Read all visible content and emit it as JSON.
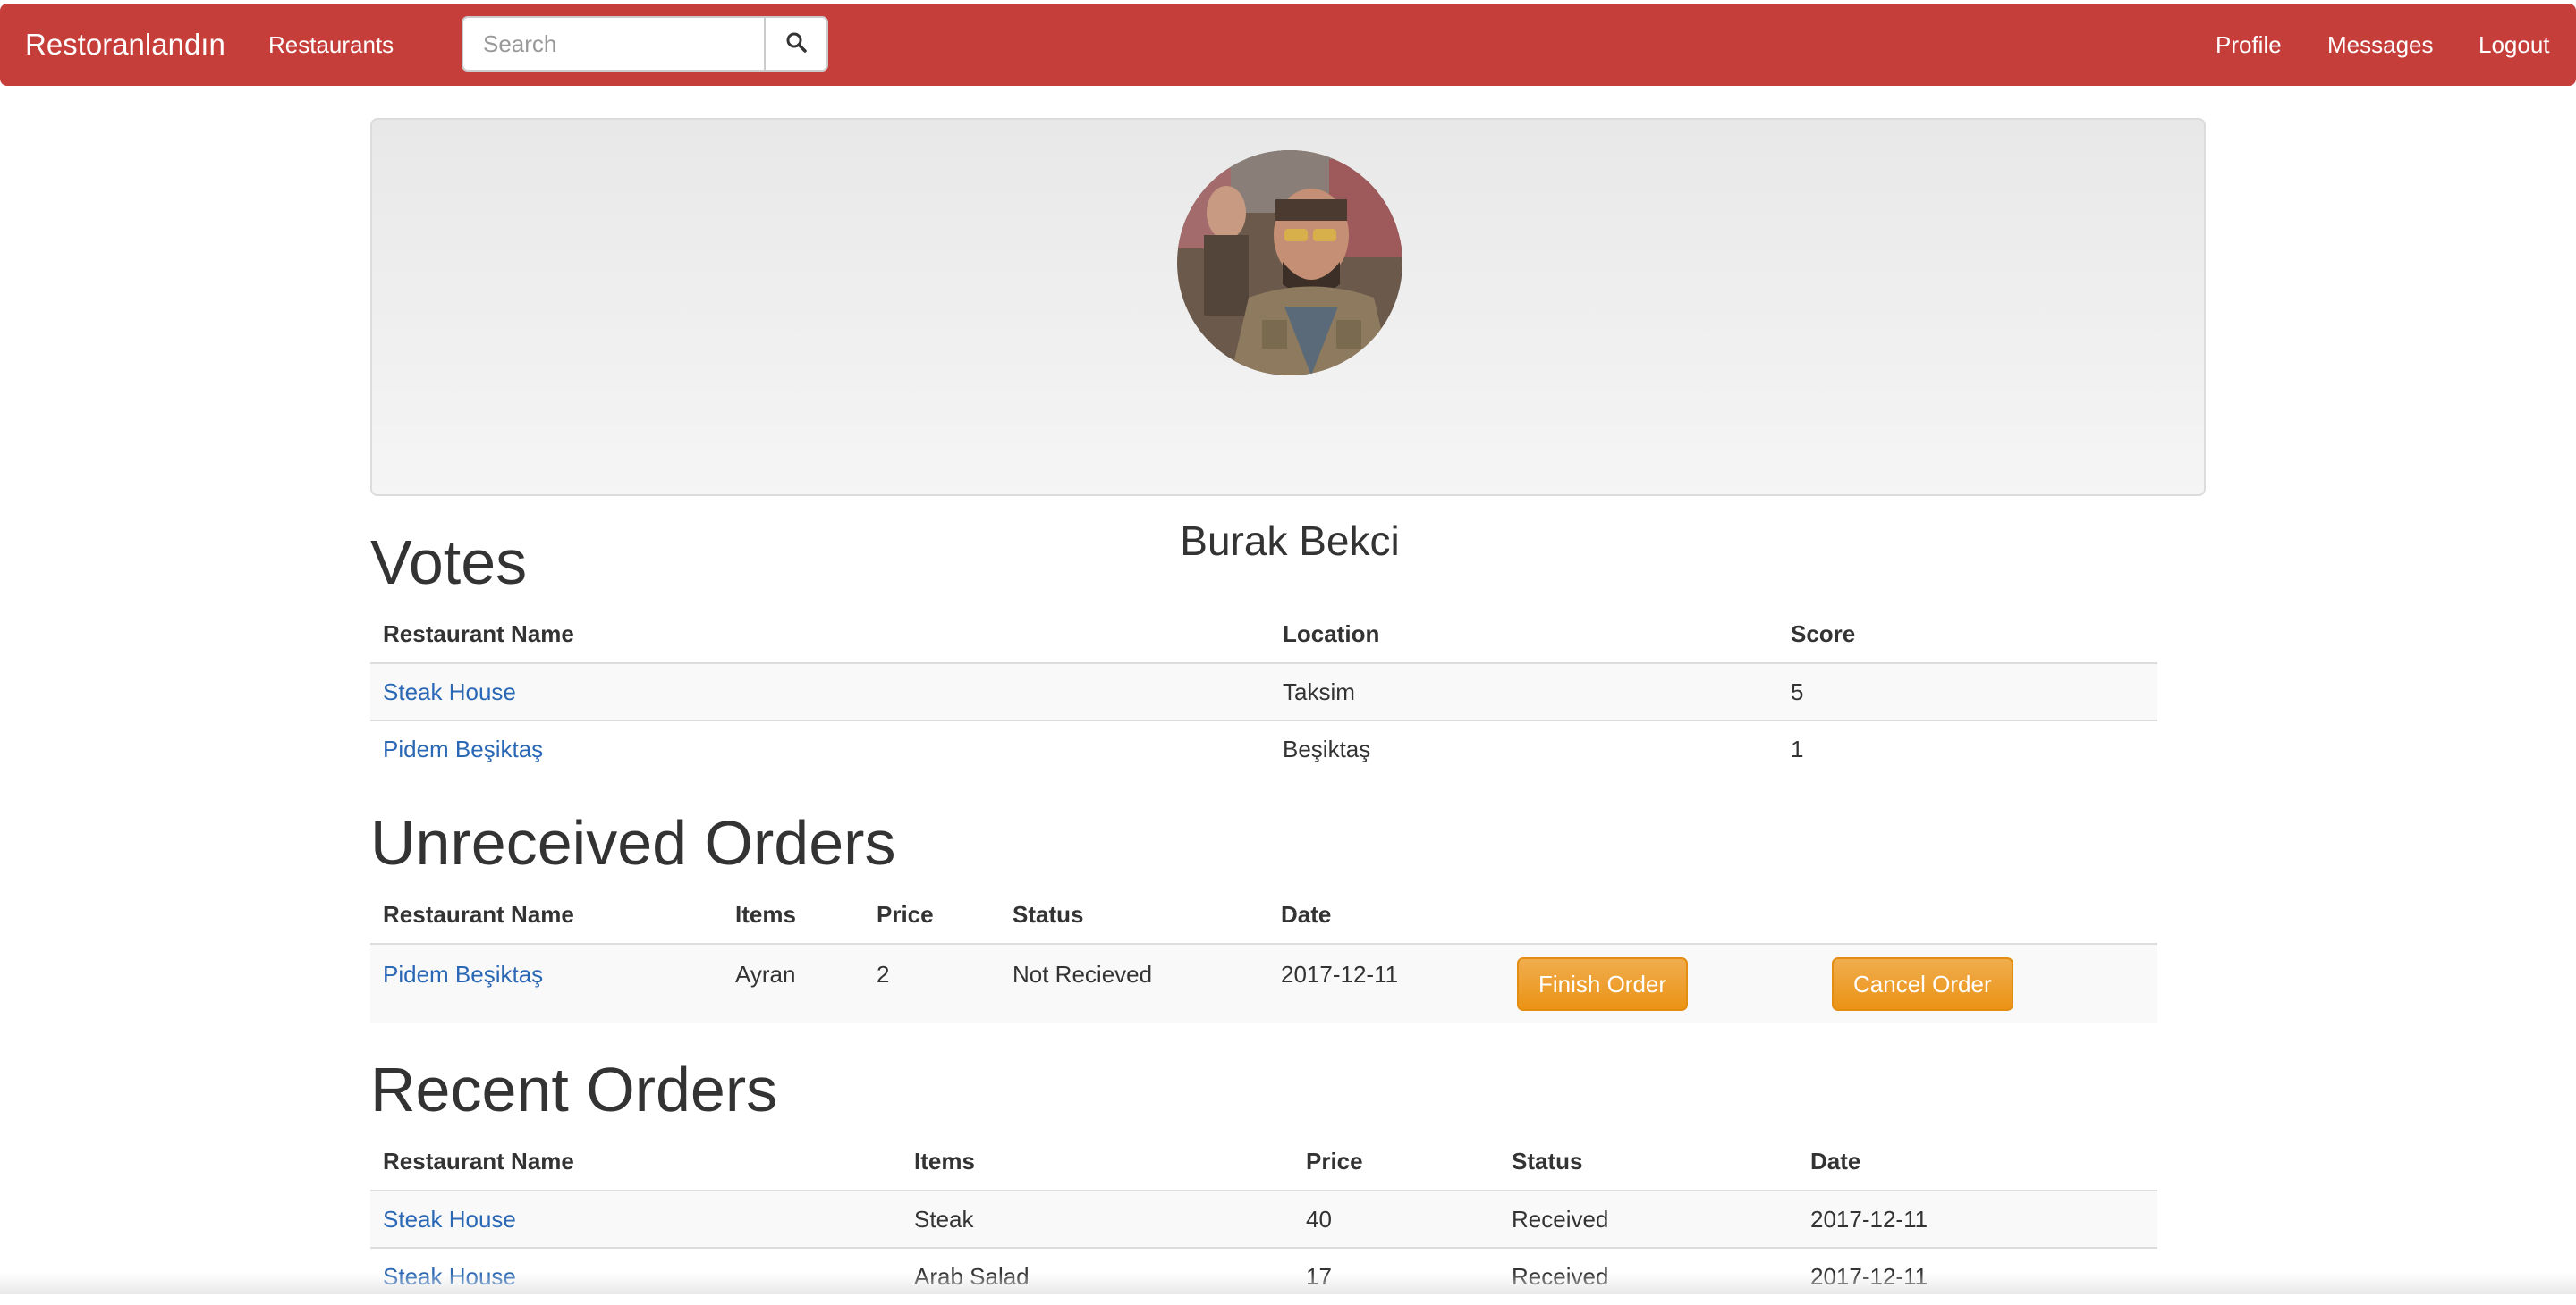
{
  "navbar": {
    "brand": "Restoranlandın",
    "restaurants": "Restaurants",
    "search_placeholder": "Search",
    "profile": "Profile",
    "messages": "Messages",
    "logout": "Logout"
  },
  "profile": {
    "name": "Burak Bekci"
  },
  "votes": {
    "title": "Votes",
    "headers": [
      "Restaurant Name",
      "Location",
      "Score"
    ],
    "rows": [
      {
        "restaurant": "Steak House",
        "location": "Taksim",
        "score": "5"
      },
      {
        "restaurant": "Pidem Beşiktaş",
        "location": "Beşiktaş",
        "score": "1"
      }
    ]
  },
  "unreceived": {
    "title": "Unreceived Orders",
    "headers": [
      "Restaurant Name",
      "Items",
      "Price",
      "Status",
      "Date"
    ],
    "rows": [
      {
        "restaurant": "Pidem Beşiktaş",
        "items": "Ayran",
        "price": "2",
        "status": "Not Recieved",
        "date": "2017-12-11",
        "finish_label": "Finish Order",
        "cancel_label": "Cancel Order"
      }
    ]
  },
  "recent": {
    "title": "Recent Orders",
    "headers": [
      "Restaurant Name",
      "Items",
      "Price",
      "Status",
      "Date"
    ],
    "rows": [
      {
        "restaurant": "Steak House",
        "items": "Steak",
        "price": "40",
        "status": "Received",
        "date": "2017-12-11"
      },
      {
        "restaurant": "Steak House",
        "items": "Arab Salad",
        "price": "17",
        "status": "Received",
        "date": "2017-12-11"
      }
    ]
  },
  "colors": {
    "navbar": "#c63e3a",
    "link": "#2a68b5",
    "warning": "#f0ad4e"
  },
  "icons": {
    "search": "search-icon"
  }
}
